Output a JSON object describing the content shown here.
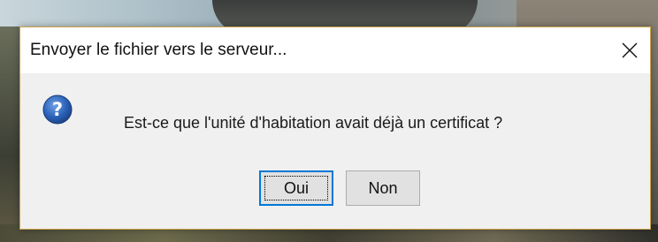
{
  "dialog": {
    "title": "Envoyer le fichier vers le serveur...",
    "message": "Est-ce que l'unité d'habitation avait déjà un certificat ?",
    "icon": "question-icon",
    "buttons": {
      "yes_label": "Oui",
      "no_label": "Non"
    }
  },
  "colors": {
    "focus_border": "#0078d7",
    "icon_blue": "#2a62b8",
    "dialog_bg": "#f0f0f0",
    "titlebar_bg": "#ffffff"
  }
}
